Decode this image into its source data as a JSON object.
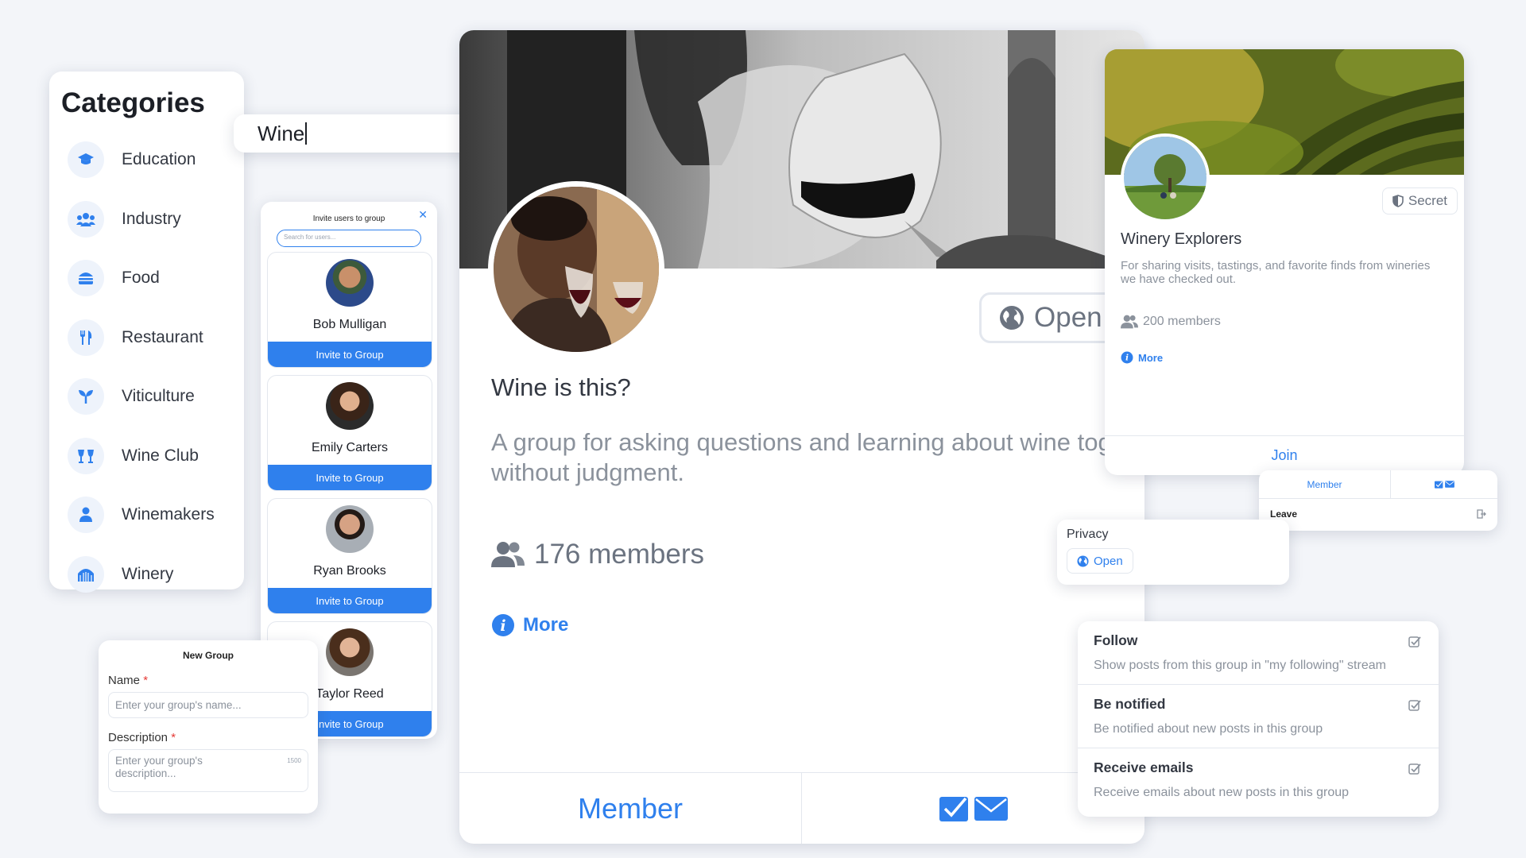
{
  "categories": {
    "title": "Categories",
    "items": [
      {
        "label": "Education",
        "icon": "graduation-cap-icon"
      },
      {
        "label": "Industry",
        "icon": "users-icon"
      },
      {
        "label": "Food",
        "icon": "burger-icon"
      },
      {
        "label": "Restaurant",
        "icon": "utensils-icon"
      },
      {
        "label": "Viticulture",
        "icon": "sprout-icon"
      },
      {
        "label": "Wine Club",
        "icon": "wine-glasses-icon"
      },
      {
        "label": "Winemakers",
        "icon": "person-icon"
      },
      {
        "label": "Winery",
        "icon": "barrel-icon"
      }
    ]
  },
  "search": {
    "value": "Wine",
    "icon": "search-icon"
  },
  "invite": {
    "title": "Invite users to group",
    "search_placeholder": "Search for users...",
    "button_label": "Invite to Group",
    "users": [
      {
        "name": "Bob Mulligan"
      },
      {
        "name": "Emily Carters"
      },
      {
        "name": "Ryan Brooks"
      },
      {
        "name": "Taylor Reed"
      }
    ]
  },
  "new_group": {
    "title": "New Group",
    "name_label": "Name",
    "name_placeholder": "Enter your group's name...",
    "desc_label": "Description",
    "desc_placeholder": "Enter your group's description...",
    "required_mark": "*",
    "char_limit": "1500"
  },
  "main_group": {
    "privacy": "Open",
    "title": "Wine is this?",
    "description": "A group for asking questions and learning about wine together without judgment.",
    "members": "176 members",
    "more": "More",
    "member_button": "Member"
  },
  "winery_group": {
    "privacy": "Secret",
    "name": "Winery Explorers",
    "description": "For sharing visits, tastings, and favorite finds from wineries we have checked out.",
    "members": "200 members",
    "more": "More",
    "join": "Join"
  },
  "member_menu": {
    "member": "Member",
    "leave": "Leave"
  },
  "privacy_card": {
    "label": "Privacy",
    "value": "Open"
  },
  "notifications": [
    {
      "title": "Follow",
      "description": "Show posts from this group in \"my following\" stream"
    },
    {
      "title": "Be notified",
      "description": "Be notified about new posts in this group"
    },
    {
      "title": "Receive emails",
      "description": "Receive emails about new posts in this group"
    }
  ],
  "colors": {
    "accent": "#2f80ed",
    "background": "#f3f5f9",
    "muted": "#8b929c"
  }
}
